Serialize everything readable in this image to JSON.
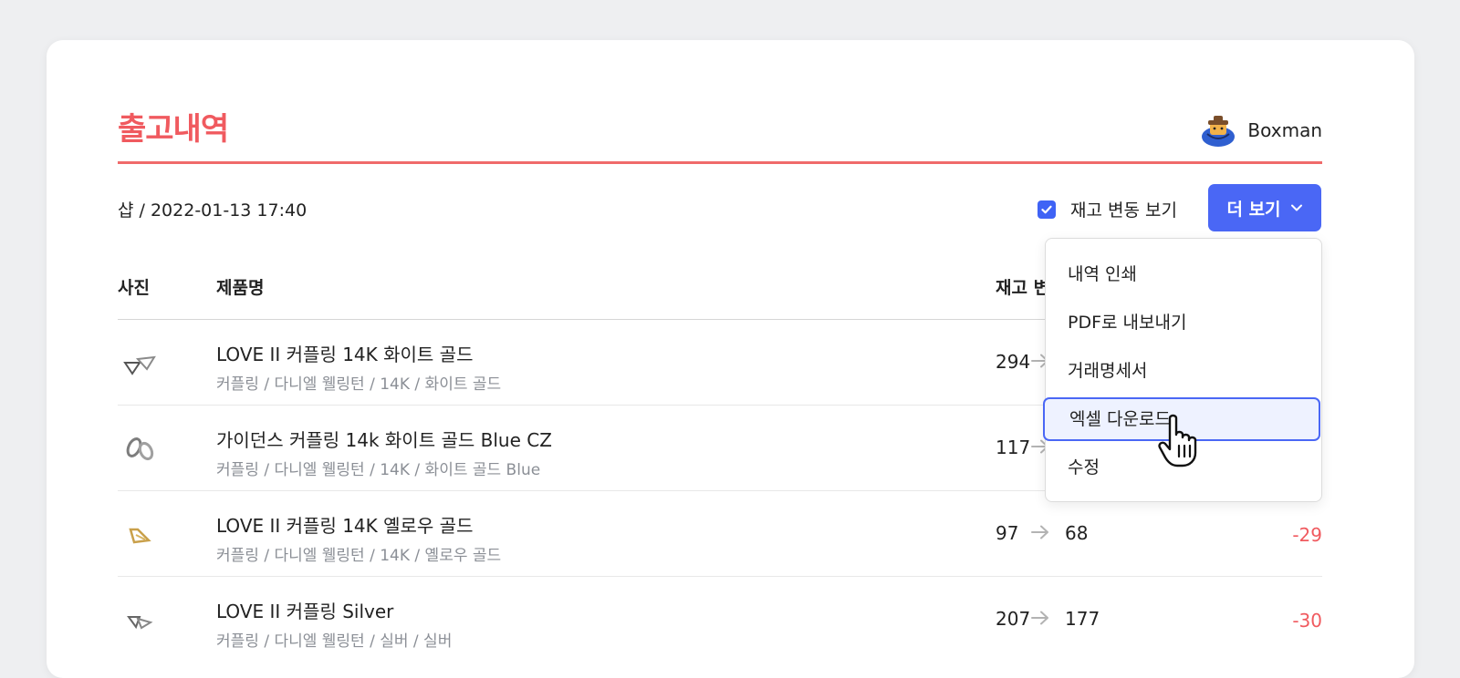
{
  "header": {
    "title": "출고내역",
    "username": "Boxman"
  },
  "meta": {
    "text": "샵 / 2022-01-13 17:40"
  },
  "controls": {
    "show_stock_change_label": "재고 변동 보기",
    "show_stock_change_checked": true,
    "more_label": "더 보기"
  },
  "table": {
    "columns": {
      "photo": "사진",
      "name": "제품명",
      "stock_change": "재고 변"
    },
    "rows": [
      {
        "name": "LOVE II 커플링 14K 화이트 골드",
        "sub": "커플링 / 다니엘 웰링턴 / 14K / 화이트 골드",
        "before": "294",
        "after": "",
        "diff": ""
      },
      {
        "name": "가이던스 커플링 14k 화이트 골드 Blue CZ",
        "sub": "커플링 / 다니엘 웰링턴 / 14K / 화이트 골드 Blue",
        "before": "117",
        "after": "",
        "diff": ""
      },
      {
        "name": "LOVE II 커플링 14K 옐로우 골드",
        "sub": "커플링 / 다니엘 웰링턴 / 14K / 옐로우 골드",
        "before": "97",
        "after": "68",
        "diff": "-29"
      },
      {
        "name": "LOVE II 커플링 Silver",
        "sub": "커플링 / 다니엘 웰링턴 / 실버 / 실버",
        "before": "207",
        "after": "177",
        "diff": "-30"
      }
    ]
  },
  "dropdown": {
    "items": [
      {
        "label": "내역 인쇄"
      },
      {
        "label": "PDF로 내보내기"
      },
      {
        "label": "거래명세서"
      },
      {
        "label": "엑셀 다운로드",
        "active": true
      },
      {
        "label": "수정"
      }
    ]
  },
  "colors": {
    "accent_red": "#f05a5f",
    "primary_blue": "#4a67f5",
    "muted_text": "#8b8f96"
  }
}
